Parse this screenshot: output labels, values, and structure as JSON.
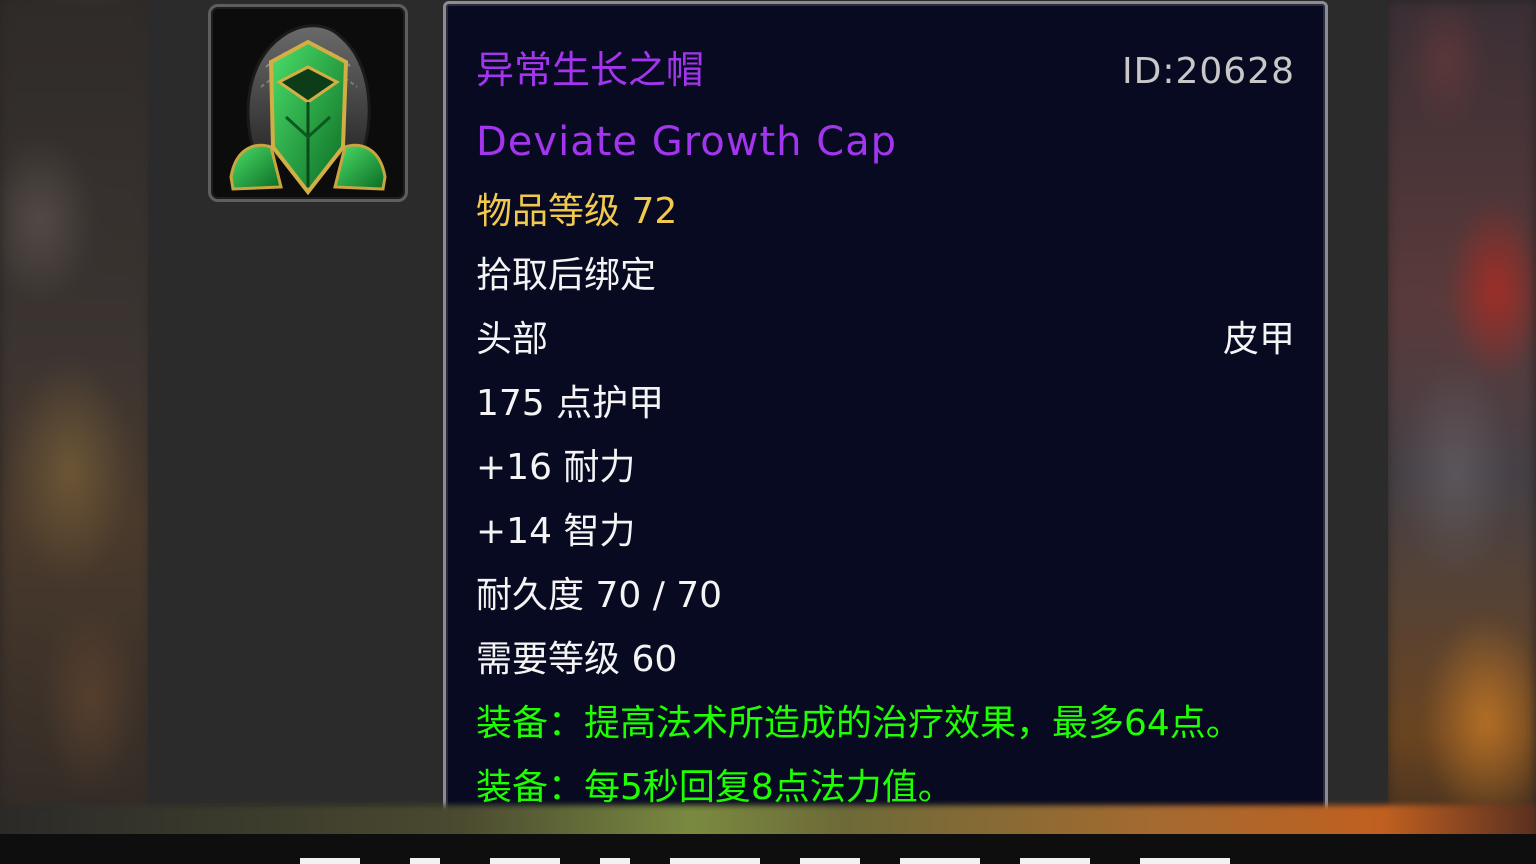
{
  "item": {
    "name_cn": "异常生长之帽",
    "id_label": "ID:20628",
    "name_en": "Deviate Growth Cap",
    "item_level": "物品等级 72",
    "binding": "拾取后绑定",
    "slot": "头部",
    "armor_type": "皮甲",
    "armor": "175 点护甲",
    "stamina": "+16 耐力",
    "intellect": "+14 智力",
    "durability": "耐久度 70 / 70",
    "required_level": "需要等级 60",
    "equip_effects": [
      "装备：提高法术所造成的治疗效果，最多64点。",
      "装备：每5秒回复8点法力值。"
    ],
    "icon": "green-leather-hood-icon"
  },
  "colors": {
    "epic_purple": "#a335ee",
    "item_level_gold": "#f0c94e",
    "equip_green": "#1eff00",
    "tooltip_bg": "#070a21",
    "tooltip_border": "#8c8c95"
  }
}
